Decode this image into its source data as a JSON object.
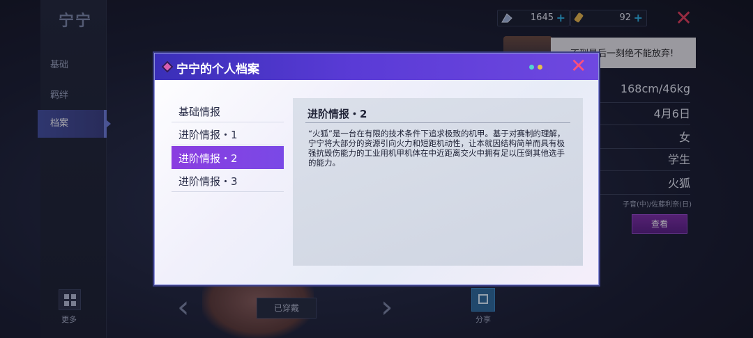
{
  "background": {
    "character_name": "宁宁",
    "nav": [
      "基础",
      "羁绊",
      "档案"
    ],
    "active_nav": "档案",
    "more_label": "更多",
    "resources": [
      {
        "icon": "crystal-icon",
        "value": "1645"
      },
      {
        "icon": "ticket-icon",
        "value": "92"
      }
    ],
    "quote": "不到最后一刻绝不能放弃!",
    "info": [
      "168cm/46kg",
      "4月6日",
      "女",
      "学生",
      "火狐"
    ],
    "cv": "子音(中)/佐藤利奈(日)",
    "view_button": "查看",
    "worn_button": "已穿戴",
    "share_label": "分享"
  },
  "modal": {
    "title": "宁宁的个人档案",
    "tabs": [
      "基础情报",
      "进阶情报・1",
      "进阶情报・2",
      "进阶情报・3"
    ],
    "active_tab": "进阶情报・2",
    "content_title": "进阶情报・2",
    "content_text": "“火狐”是一台在有限的技术条件下追求极致的机甲。基于对赛制的理解，宁宁将大部分的资源引向火力和短距机动性，让本就因结构简单而具有极强抗毁伤能力的工业用机甲机体在中近距离交火中拥有足以压倒其他选手的能力。"
  },
  "colors": {
    "accent_purple": "#7a49e6",
    "header_blue": "#3a2fb8",
    "close_red": "#ff4f7a",
    "share_blue": "#2f6a9c"
  }
}
